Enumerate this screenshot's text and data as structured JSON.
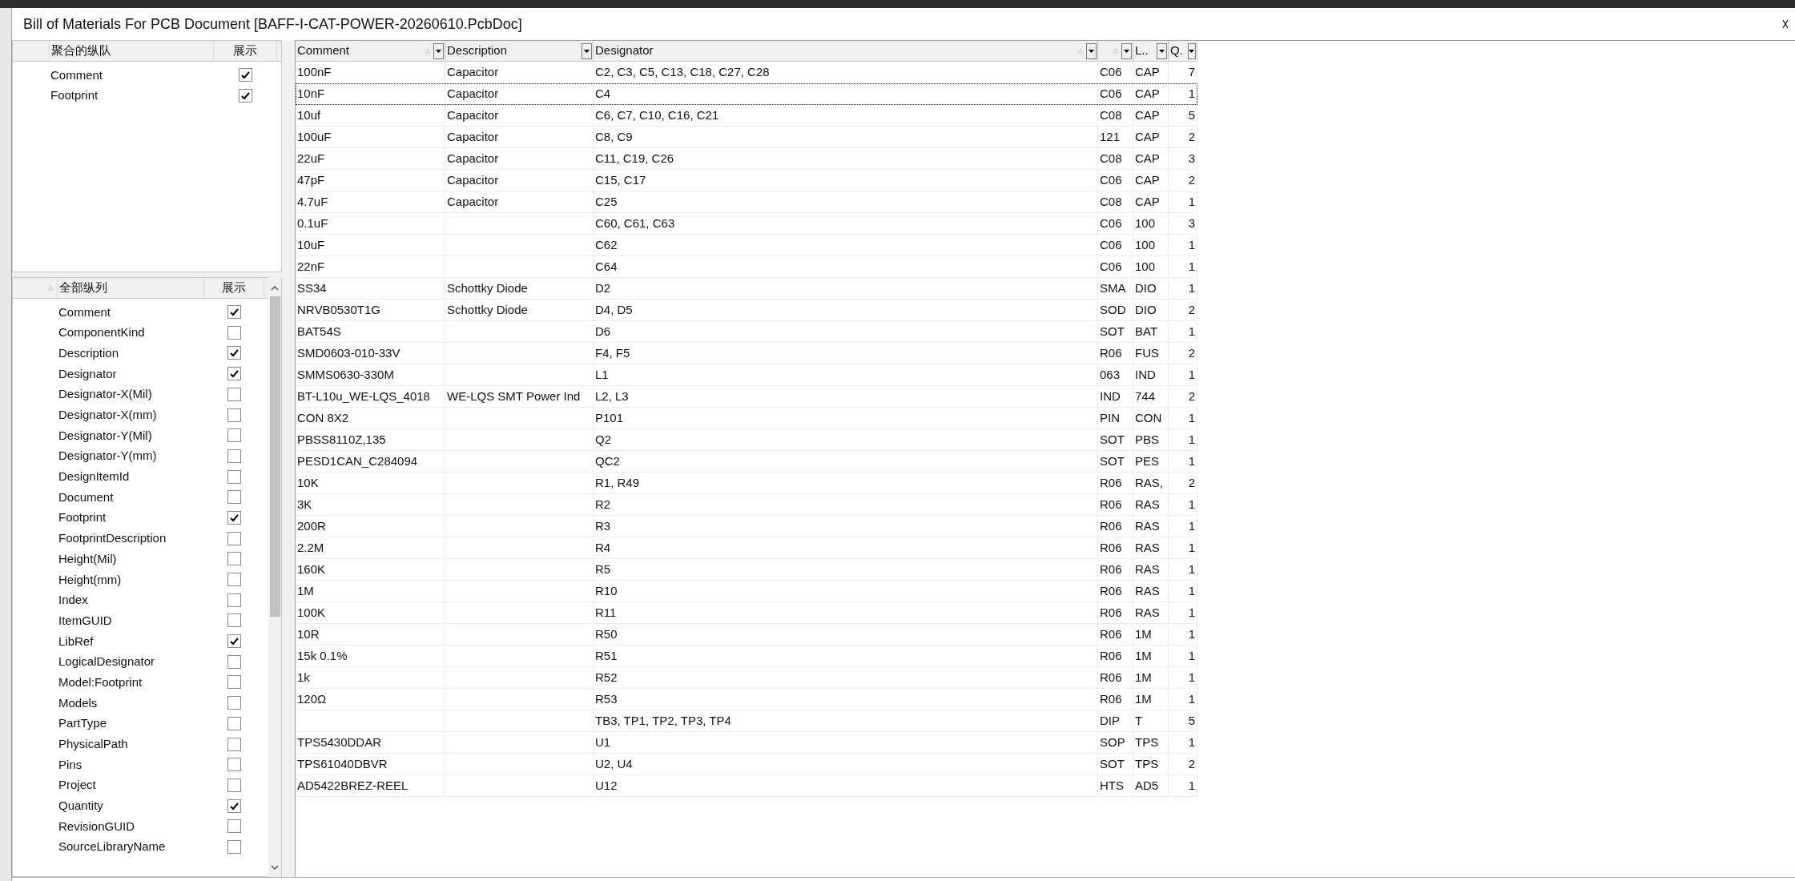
{
  "window": {
    "title": "Bill of Materials For PCB Document [BAFF-I-CAT-POWER-20260610.PcbDoc]"
  },
  "grouped_columns": {
    "headers": [
      "聚合的纵队",
      "展示"
    ],
    "items": [
      {
        "label": "Comment",
        "checked": true
      },
      {
        "label": "Footprint",
        "checked": true
      }
    ]
  },
  "all_columns": {
    "headers": [
      "全部纵列",
      "展示"
    ],
    "items": [
      {
        "label": "Comment",
        "checked": true
      },
      {
        "label": "ComponentKind",
        "checked": false
      },
      {
        "label": "Description",
        "checked": true
      },
      {
        "label": "Designator",
        "checked": true
      },
      {
        "label": "Designator-X(Mil)",
        "checked": false
      },
      {
        "label": "Designator-X(mm)",
        "checked": false
      },
      {
        "label": "Designator-Y(Mil)",
        "checked": false
      },
      {
        "label": "Designator-Y(mm)",
        "checked": false
      },
      {
        "label": "DesignItemId",
        "checked": false
      },
      {
        "label": "Document",
        "checked": false
      },
      {
        "label": "Footprint",
        "checked": true
      },
      {
        "label": "FootprintDescription",
        "checked": false
      },
      {
        "label": "Height(Mil)",
        "checked": false
      },
      {
        "label": "Height(mm)",
        "checked": false
      },
      {
        "label": "Index",
        "checked": false
      },
      {
        "label": "ItemGUID",
        "checked": false
      },
      {
        "label": "LibRef",
        "checked": true
      },
      {
        "label": "LogicalDesignator",
        "checked": false
      },
      {
        "label": "Model:Footprint",
        "checked": false
      },
      {
        "label": "Models",
        "checked": false
      },
      {
        "label": "PartType",
        "checked": false
      },
      {
        "label": "PhysicalPath",
        "checked": false
      },
      {
        "label": "Pins",
        "checked": false
      },
      {
        "label": "Project",
        "checked": false
      },
      {
        "label": "Quantity",
        "checked": true
      },
      {
        "label": "RevisionGUID",
        "checked": false
      },
      {
        "label": "SourceLibraryName",
        "checked": false
      }
    ]
  },
  "table": {
    "columns": [
      {
        "label": "Comment"
      },
      {
        "label": "Description"
      },
      {
        "label": "Designator"
      },
      {},
      {
        "label": "L.."
      },
      {
        "label": "Q."
      }
    ],
    "rows": [
      {
        "comment": "100nF",
        "description": "Capacitor",
        "designator": "C2, C3, C5, C13, C18, C27, C28",
        "column_4": "C06",
        "column_5": "CAP",
        "column_6": "7",
        "focused": false
      },
      {
        "comment": "10nF",
        "description": "Capacitor",
        "designator": "C4",
        "column_4": "C06",
        "column_5": "CAP",
        "column_6": "1",
        "focused": true
      },
      {
        "comment": "10uf",
        "description": "Capacitor",
        "designator": "C6, C7, C10, C16, C21",
        "column_4": "C08",
        "column_5": "CAP",
        "column_6": "5",
        "focused": false
      },
      {
        "comment": "100uF",
        "description": "Capacitor",
        "designator": "C8, C9",
        "column_4": "121",
        "column_5": "CAP",
        "column_6": "2",
        "focused": false
      },
      {
        "comment": "22uF",
        "description": "Capacitor",
        "designator": "C11, C19, C26",
        "column_4": "C08",
        "column_5": "CAP",
        "column_6": "3",
        "focused": false
      },
      {
        "comment": "47pF",
        "description": "Capacitor",
        "designator": "C15, C17",
        "column_4": "C06",
        "column_5": "CAP",
        "column_6": "2",
        "focused": false
      },
      {
        "comment": "4.7uF",
        "description": "Capacitor",
        "designator": "C25",
        "column_4": "C08",
        "column_5": "CAP",
        "column_6": "1",
        "focused": false
      },
      {
        "comment": "0.1uF",
        "designator": "C60, C61, C63",
        "column_4": "C06",
        "column_5": "100",
        "column_6": "3",
        "focused": false
      },
      {
        "comment": "10uF",
        "designator": "C62",
        "column_4": "C06",
        "column_5": "100",
        "column_6": "1",
        "focused": false
      },
      {
        "comment": "22nF",
        "designator": "C64",
        "column_4": "C06",
        "column_5": "100",
        "column_6": "1",
        "focused": false
      },
      {
        "comment": "SS34",
        "description": "Schottky Diode",
        "designator": "D2",
        "column_4": "SMA",
        "column_5": "DIO",
        "column_6": "1",
        "focused": false
      },
      {
        "comment": "NRVB0530T1G",
        "description": "Schottky Diode",
        "designator": "D4, D5",
        "column_4": "SOD",
        "column_5": "DIO",
        "column_6": "2",
        "focused": false
      },
      {
        "comment": "BAT54S",
        "designator": "D6",
        "column_4": "SOT",
        "column_5": "BAT",
        "column_6": "1",
        "focused": false
      },
      {
        "comment": "SMD0603-010-33V",
        "designator": "F4, F5",
        "column_4": "R06",
        "column_5": "FUS",
        "column_6": "2",
        "focused": false
      },
      {
        "comment": "SMMS0630-330M",
        "designator": "L1",
        "column_4": "063",
        "column_5": "IND",
        "column_6": "1",
        "focused": false
      },
      {
        "comment": "BT-L10u_WE-LQS_4018",
        "description": "WE-LQS SMT Power Ind",
        "designator": "L2, L3",
        "column_4": "IND",
        "column_5": "744",
        "column_6": "2",
        "focused": false
      },
      {
        "comment": "CON 8X2",
        "designator": "P101",
        "column_4": "PIN",
        "column_5": "CON",
        "column_6": "1",
        "focused": false
      },
      {
        "comment": "PBSS8110Z,135",
        "designator": "Q2",
        "column_4": "SOT",
        "column_5": "PBS",
        "column_6": "1",
        "focused": false
      },
      {
        "comment": "PESD1CAN_C284094",
        "designator": "QC2",
        "column_4": "SOT",
        "column_5": "PES",
        "column_6": "1",
        "focused": false
      },
      {
        "comment": "10K",
        "designator": "R1, R49",
        "column_4": "R06",
        "column_5": "RAS,",
        "column_6": "2",
        "focused": false
      },
      {
        "comment": "3K",
        "designator": "R2",
        "column_4": "R06",
        "column_5": "RAS",
        "column_6": "1",
        "focused": false
      },
      {
        "comment": "200R",
        "designator": "R3",
        "column_4": "R06",
        "column_5": "RAS",
        "column_6": "1",
        "focused": false
      },
      {
        "comment": "2.2M",
        "designator": "R4",
        "column_4": "R06",
        "column_5": "RAS",
        "column_6": "1",
        "focused": false
      },
      {
        "comment": "160K",
        "designator": "R5",
        "column_4": "R06",
        "column_5": "RAS",
        "column_6": "1",
        "focused": false
      },
      {
        "comment": "1M",
        "designator": "R10",
        "column_4": "R06",
        "column_5": "RAS",
        "column_6": "1",
        "focused": false
      },
      {
        "comment": "100K",
        "designator": "R11",
        "column_4": "R06",
        "column_5": "RAS",
        "column_6": "1",
        "focused": false
      },
      {
        "comment": "10R",
        "designator": "R50",
        "column_4": "R06",
        "column_5": "1M",
        "column_6": "1",
        "focused": false
      },
      {
        "comment": "15k 0.1%",
        "designator": "R51",
        "column_4": "R06",
        "column_5": "1M",
        "column_6": "1",
        "focused": false
      },
      {
        "comment": "1k",
        "designator": "R52",
        "column_4": "R06",
        "column_5": "1M",
        "column_6": "1",
        "focused": false
      },
      {
        "comment": "120Ω",
        "designator": "R53",
        "column_4": "R06",
        "column_5": "1M",
        "column_6": "1",
        "focused": false
      },
      {
        "designator": "TB3, TP1, TP2, TP3, TP4",
        "column_4": "DIP",
        "column_5": "T",
        "column_6": "5",
        "focused": false
      },
      {
        "comment": "TPS5430DDAR",
        "designator": "U1",
        "column_4": "SOP",
        "column_5": "TPS",
        "column_6": "1",
        "focused": false
      },
      {
        "comment": "TPS61040DBVR",
        "designator": "U2, U4",
        "column_4": "SOT",
        "column_5": "TPS",
        "column_6": "2",
        "focused": false
      },
      {
        "comment": "AD5422BREZ-REEL",
        "designator": "U12",
        "column_4": "HTS",
        "column_5": "AD5",
        "column_6": "1",
        "focused": false
      }
    ]
  }
}
